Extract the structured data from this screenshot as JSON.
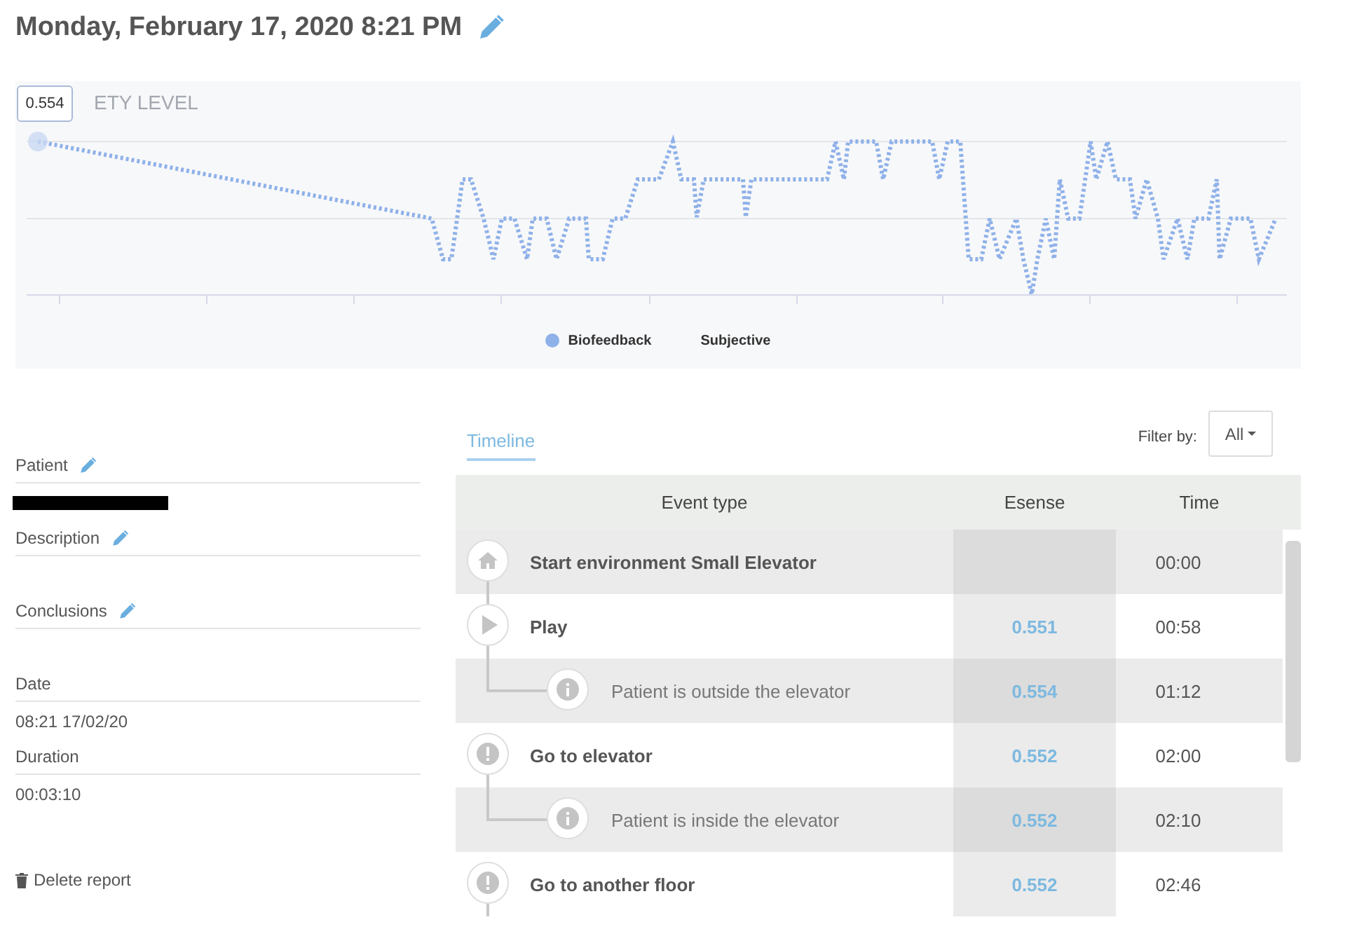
{
  "title": "Monday, February 17, 2020 8:21 PM",
  "chart": {
    "title": "ETY LEVEL",
    "tooltip": "0.554",
    "legend": [
      {
        "label": "Biofeedback",
        "kind": "dot",
        "color": "#8fb1e9"
      },
      {
        "label": "Subjective",
        "kind": "plain"
      }
    ]
  },
  "details": [
    {
      "label": "Patient",
      "editable": true,
      "kind": "redacted"
    },
    {
      "label": "Description",
      "editable": true
    },
    {
      "label": "Conclusions",
      "editable": true
    },
    {
      "label": "Date",
      "editable": false,
      "value": "08:21 17/02/20"
    },
    {
      "label": "Duration",
      "editable": false,
      "value": "00:03:10"
    }
  ],
  "delete_button": "Delete report",
  "tabs": [
    {
      "label": "Timeline",
      "selected": true
    }
  ],
  "filter": {
    "label": "Filter by:",
    "value": "All"
  },
  "table": {
    "columns": [
      "Event type",
      "Esense",
      "Time"
    ],
    "rows": [
      {
        "kind": "home",
        "event": "Start environment Small Elevator",
        "time": "00:00"
      },
      {
        "kind": "play",
        "event": "Play",
        "esense": "0.551",
        "time": "00:58",
        "children": [
          {
            "kind": "info",
            "event": "Patient is outside the elevator",
            "esense": "0.554",
            "time": "01:12"
          }
        ]
      },
      {
        "kind": "alert",
        "event": "Go to elevator",
        "esense": "0.552",
        "time": "02:00",
        "children": [
          {
            "kind": "info",
            "event": "Patient is inside the elevator",
            "esense": "0.552",
            "time": "02:10"
          }
        ]
      },
      {
        "kind": "alert",
        "event": "Go to another floor",
        "esense": "0.552",
        "time": "02:46"
      }
    ]
  }
}
